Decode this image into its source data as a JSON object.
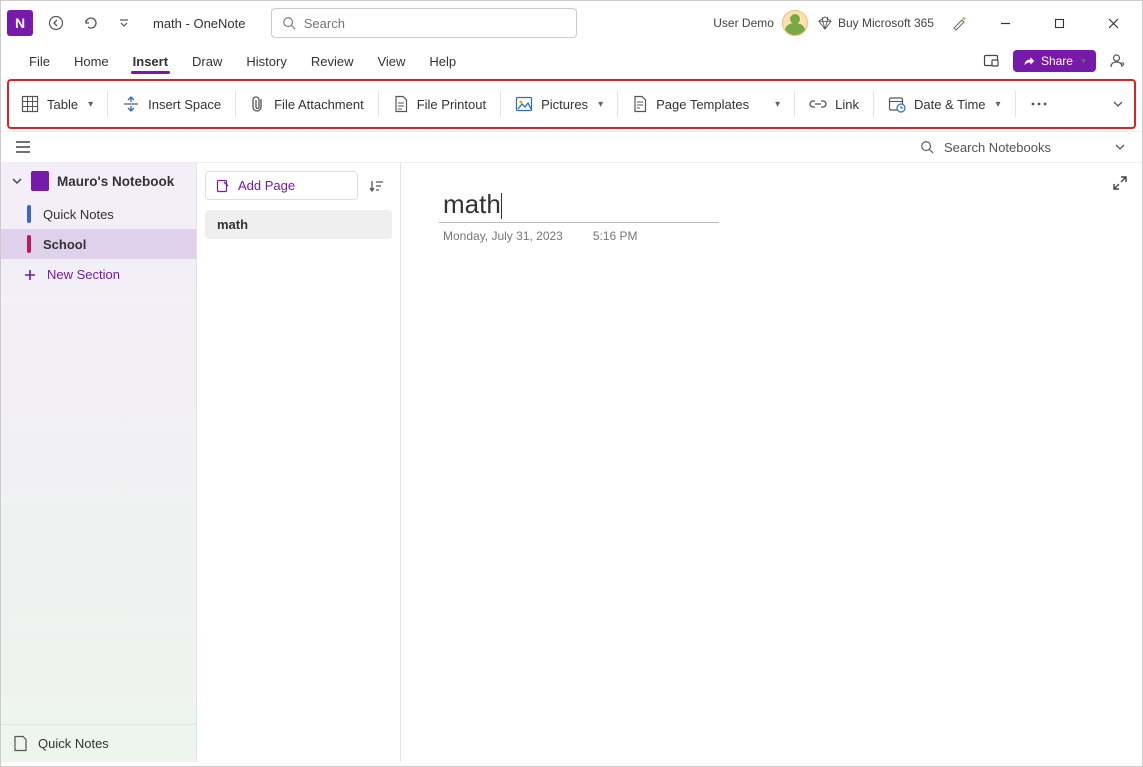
{
  "titlebar": {
    "title": "math  -  OneNote",
    "search_placeholder": "Search",
    "user_name": "User Demo",
    "buy_label": "Buy Microsoft 365"
  },
  "menus": {
    "items": [
      "File",
      "Home",
      "Insert",
      "Draw",
      "History",
      "Review",
      "View",
      "Help"
    ],
    "active_index": 2,
    "share_label": "Share"
  },
  "ribbon": {
    "table": "Table",
    "insert_space": "Insert Space",
    "file_attachment": "File Attachment",
    "file_printout": "File Printout",
    "pictures": "Pictures",
    "page_templates": "Page Templates",
    "link": "Link",
    "date_time": "Date & Time"
  },
  "secondary": {
    "search_placeholder": "Search Notebooks"
  },
  "sidebar": {
    "notebook": "Mauro's Notebook",
    "sections": [
      {
        "label": "Quick Notes",
        "color": "#3a66c7"
      },
      {
        "label": "School",
        "color": "#c2185b"
      }
    ],
    "selected_section": 1,
    "new_section": "New Section",
    "footer": "Quick Notes"
  },
  "pagelist": {
    "add_page": "Add Page",
    "pages": [
      "math"
    ],
    "selected_page": 0
  },
  "note": {
    "title": "math",
    "date": "Monday, July 31, 2023",
    "time": "5:16 PM"
  }
}
